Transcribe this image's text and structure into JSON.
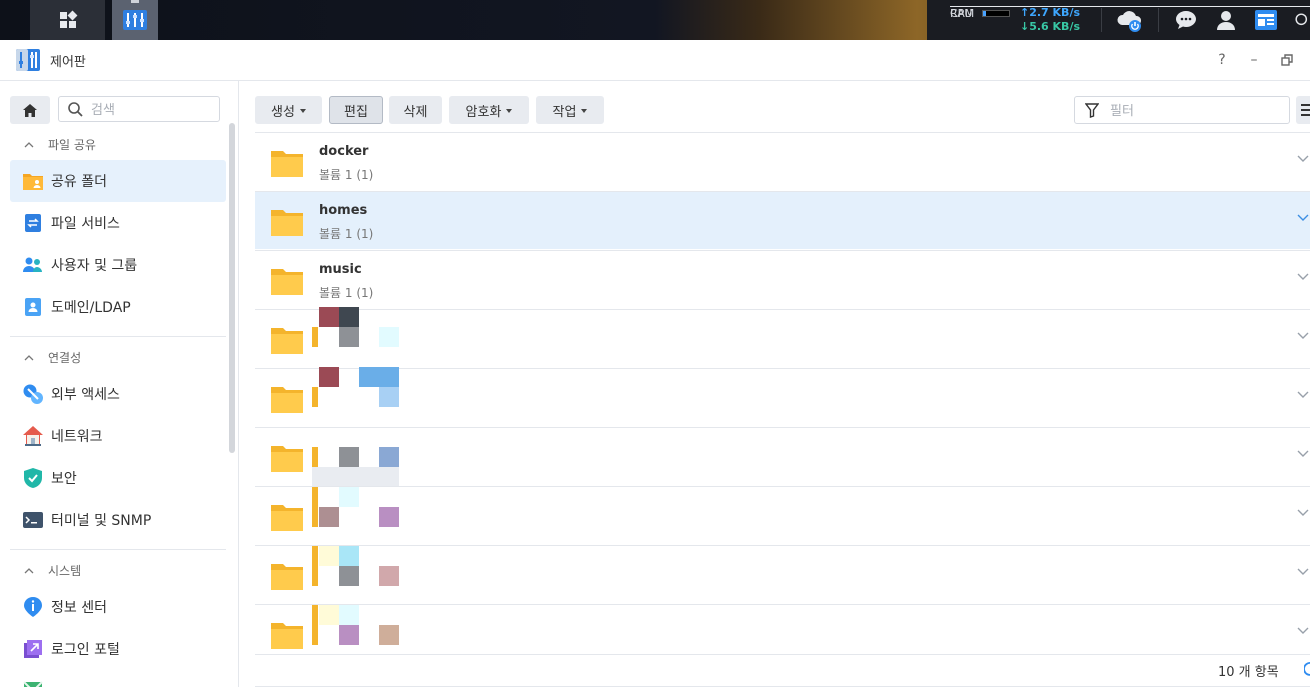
{
  "taskbar": {
    "cpu_label": "CPU",
    "ram_label": "RAM",
    "upload": "2.7 KB/s",
    "download": "5.6 KB/s"
  },
  "window": {
    "title": "제어판",
    "help": "?",
    "minimize": "–"
  },
  "sidebar": {
    "search_placeholder": "검색",
    "sections": [
      {
        "title": "파일 공유",
        "items": [
          "공유 폴더",
          "파일 서비스",
          "사용자 및 그룹",
          "도메인/LDAP"
        ]
      },
      {
        "title": "연결성",
        "items": [
          "외부 액세스",
          "네트워크",
          "보안",
          "터미널 및 SNMP"
        ]
      },
      {
        "title": "시스템",
        "items": [
          "정보 센터",
          "로그인 포털"
        ]
      }
    ],
    "active_item": "공유 폴더"
  },
  "toolbar": {
    "create": "생성",
    "edit": "편집",
    "delete": "삭제",
    "encrypt": "암호화",
    "action": "작업",
    "filter_placeholder": "필터"
  },
  "folders": [
    {
      "name": "docker",
      "volume": "볼륨 1 (1)"
    },
    {
      "name": "homes",
      "volume": "볼륨 1 (1)",
      "selected": true
    },
    {
      "name": "music",
      "volume": "볼륨 1 (1)"
    }
  ],
  "footer": {
    "count": "10 개 항목"
  },
  "colors": {
    "accent": "#3b8ee3",
    "selected_row": "#e4f0fc",
    "folder": "#ffcb4c"
  }
}
